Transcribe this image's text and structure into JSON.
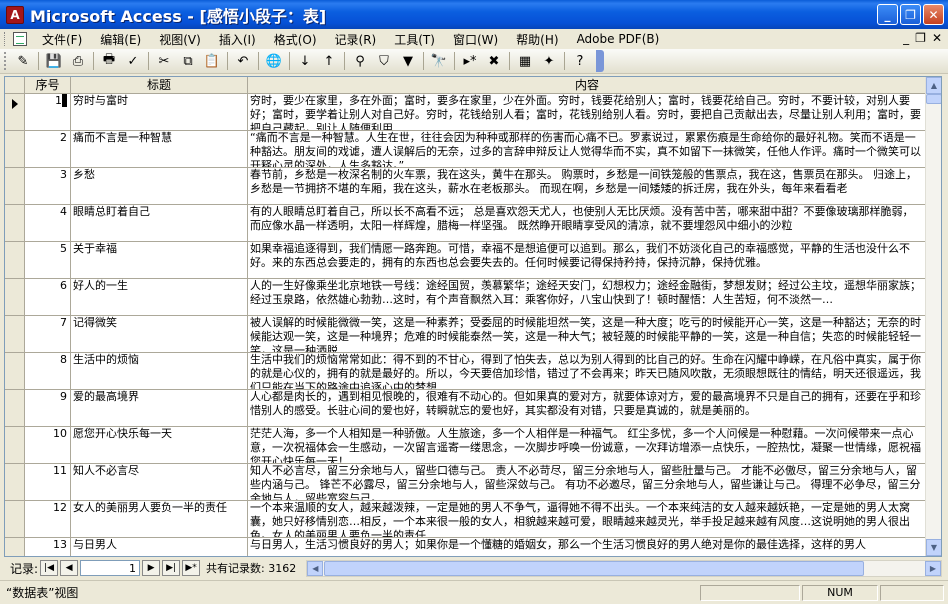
{
  "window": {
    "title": "Microsoft Access - [感悟小段子：表]",
    "icon_letter": "A"
  },
  "menu": [
    "文件(F)",
    "编辑(E)",
    "视图(V)",
    "插入(I)",
    "格式(O)",
    "记录(R)",
    "工具(T)",
    "窗口(W)",
    "帮助(H)",
    "Adobe PDF(B)"
  ],
  "toolbar": {
    "icons": [
      "view-design-icon",
      "save-icon",
      "print-preview-icon",
      "print-icon",
      "spelling-icon",
      "cut-icon",
      "copy-icon",
      "paste-icon",
      "undo-icon",
      "hyperlink-icon",
      "sort-ascending-icon",
      "sort-descending-icon",
      "filter-by-selection-icon",
      "filter-by-form-icon",
      "apply-filter-icon",
      "find-icon",
      "new-record-icon",
      "delete-record-icon",
      "database-window-icon",
      "new-object-icon",
      "help-icon"
    ]
  },
  "table": {
    "columns": {
      "id": "序号",
      "title": "标题",
      "content": "内容"
    },
    "rows": [
      {
        "id": "1",
        "title": "穷时与富时",
        "content": "穷时，要少在家里，多在外面；富时，要多在家里，少在外面。穷时，钱要花给别人；富时，钱要花给自己。穷时，不要计较，对别人要好；富时，要学着让别人对自己好。穷时，花钱给别人看；富时，花钱别给别人看。穷时，要把自己贡献出去，尽量让别人利用；富时，要把自己藏起，别让人随便利用"
      },
      {
        "id": "2",
        "title": "痛而不言是一种智慧",
        "content": "“痛而不言是一种智慧。人生在世，往往会因为种种或那样的伤害而心痛不已。罗素说过，累累伤痕是生命给你的最好礼物。笑而不语是一种豁达。朋友间的戏谑，遭人误解后的无奈，过多的言辞申辩反让人觉得华而不实，真不如留下一抹微笑，任他人作评。痛时一个微笑可以开释心灵的深处，人生多豁达。”"
      },
      {
        "id": "3",
        "title": "乡愁",
        "content": "春节前，乡愁是一枚深名制的火车票，我在这头，黄牛在那头。 购票时，乡愁是一间铁笼般的售票点，我在这，售票员在那头。 归途上，乡愁是一节拥挤不堪的车厢，我在这头，薪水在老板那头。 而现在啊，乡愁是一间矮矮的拆迁房，我在外头，每年来看看老"
      },
      {
        "id": "4",
        "title": "眼睛总盯着自己",
        "content": "有的人眼睛总盯着自己，所以长不高看不远；        总是喜欢怨天尤人，也使别人无比厌烦。没有苦中苦，哪来甜中甜？不要像玻璃那样脆弱，而应像水晶一样透明，太阳一样辉煌，腊梅一样坚强。        既然睁开眼睛享受风的清凉，就不要埋怨风中细小的沙粒"
      },
      {
        "id": "5",
        "title": "关于幸福",
        "content": "如果幸福追逐得到，我们情愿一路奔跑。可惜，幸福不是想追便可以追到。那么，我们不妨淡化自己的幸福感觉，平静的生活也没什么不好。来的东西总会要走的，拥有的东西也总会要失去的。任何时候要记得保持矜持，保持沉静，保持优雅。"
      },
      {
        "id": "6",
        "title": "好人的一生",
        "content": "人的一生好像乘坐北京地铁一号线：途经国贸，羡慕繁华；途经天安门，幻想权力；途经金融街，梦想发财；经过公主坟，遥想华丽家族；经过玉泉路，依然雄心勃勃…这时，有个声音飘然入耳：乘客你好，八宝山快到了！顿时醒悟：人生苦短，何不淡然一…"
      },
      {
        "id": "7",
        "title": "记得微笑",
        "content": "被人误解的时候能微微一笑，这是一种素养；受委屈的时候能坦然一笑，这是一种大度；吃亏的时候能开心一笑，这是一种豁达；无奈的时候能达观一笑，这是一种境界；危难的时候能泰然一笑，这是一种大气；被轻蔑的时候能平静的一笑，这是一种自信；失恋的时候能轻轻一笑，这是一种洒脱"
      },
      {
        "id": "8",
        "title": "生活中的烦恼",
        "content": "生活中我们的烦恼常常如此：得不到的不甘心，得到了怕失去，总以为别人得到的比自己的好。生命在闪耀中峥嵘，在凡俗中真实，属于你的就是心仪的，拥有的就是最好的。所以，今天要倍加珍惜，错过了不会再来；昨天已随风吹散，无须眼想既往的情结，明天还很遥远，我们只能在当下的路途中追逐心中的梦想"
      },
      {
        "id": "9",
        "title": "爱的最高境界",
        "content": "人心都是肉长的，遇到相见恨晚的，很难有不动心的。但如果真的爱对方，就要体谅对方，爱的最高境界不只是自己的拥有，还要在乎和珍惜别人的感受。长驻心间的爱也好，转瞬就忘的爱也好，其实都没有对错，只要是真诚的，就是美丽的。"
      },
      {
        "id": "10",
        "title": "愿您开心快乐每一天",
        "content": "茫茫人海，多一个人相知是一种骄傲。人生旅途，多一个人相伴是一种福气。 红尘多忧，多一个人问候是一种慰藉。一次问候带来一点心意，一次祝福体会一生感动，一次留言遥寄一缕思念，一次脚步呼唤一份诚意，一次拜访增添一点快乐，一腔热忱，凝聚一世情缘，愿祝福您开心快乐每一天！"
      },
      {
        "id": "11",
        "title": "知人不必言尽",
        "content": "知人不必言尽，留三分余地与人，留些口德与己。 责人不必苛尽，留三分余地与人，留些肚量与己。 才能不必傲尽，留三分余地与人，留些内涵与己。 锋芒不必露尽，留三分余地与人，留些深敛与己。 有功不必邀尽，留三分余地与人，留些谦让与己。 得理不必争尽，留三分余地与人，留些宽容与己。"
      },
      {
        "id": "12",
        "title": "女人的美丽男人要负一半的责任",
        "content": "一个本来温顺的女人，越来越泼辣，一定是她的男人不争气，逼得她不得不出头。一个本来纯洁的女人越来越妖艳，一定是她的男人太窝囊，她只好移情别恋…相反，一个本来很一般的女人，相貌越来越可爱，眼睛越来越灵光，举手投足越来越有风度…这说明她的男人很出色。女人的美丽男人要负一半的责任"
      },
      {
        "id": "13",
        "title": "与日男人",
        "content": "与日男人，生活习惯良好的男人；如果你是一个懂糖的婚姻女，那么一个生活习惯良好的男人绝对是你的最佳选择，这样的男人"
      }
    ],
    "current_record_index": 0
  },
  "navigation": {
    "label": "记录:",
    "current": "1",
    "total_label": "共有记录数:",
    "total": "3162"
  },
  "status": {
    "view": "“数据表”视图",
    "num": "NUM"
  }
}
